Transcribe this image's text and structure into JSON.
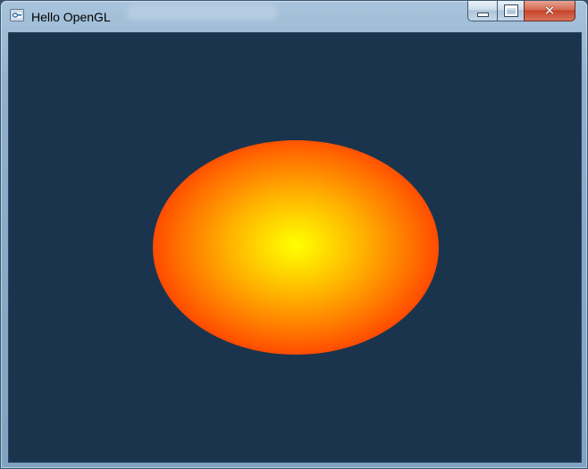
{
  "window": {
    "title": "Hello OpenGL",
    "caption_buttons": {
      "minimize_icon": "minimize-icon",
      "maximize_icon": "maximize-icon",
      "close_icon": "close-icon",
      "close_glyph": "✕"
    }
  },
  "canvas": {
    "background_color": "#1b344d",
    "shape": "ellipse",
    "center_color": "#ffff00",
    "edge_color": "#ff0000"
  }
}
